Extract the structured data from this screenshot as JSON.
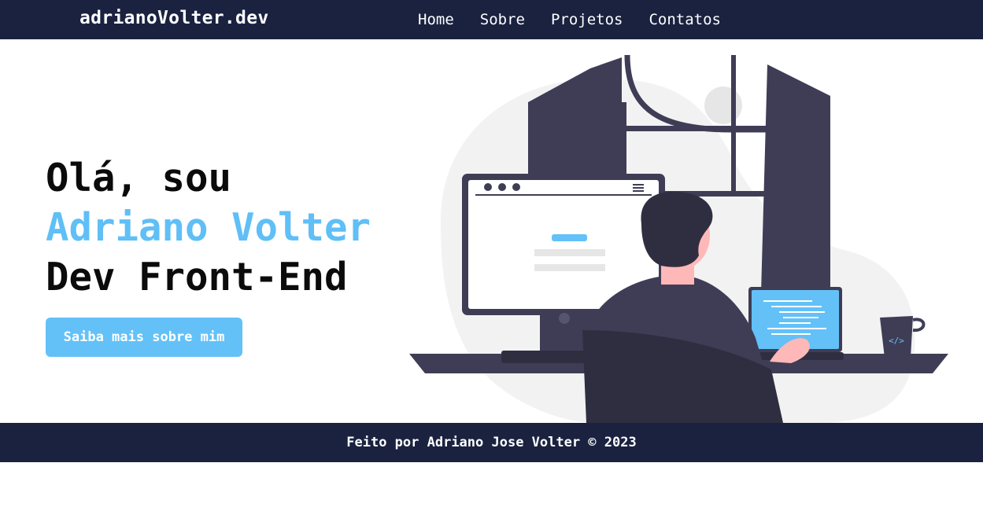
{
  "header": {
    "brand": "adrianoVolter.dev",
    "nav": [
      {
        "label": "Home"
      },
      {
        "label": "Sobre"
      },
      {
        "label": "Projetos"
      },
      {
        "label": "Contatos"
      }
    ]
  },
  "hero": {
    "greeting": "Olá, sou",
    "name": "Adriano Volter",
    "role": "Dev Front-End",
    "cta_label": "Saiba mais sobre mim"
  },
  "illustration": {
    "mug_label": "</>"
  },
  "footer": {
    "text": "Feito por Adriano Jose Volter © 2023"
  },
  "colors": {
    "navy": "#1a2240",
    "accent": "#63c1f8",
    "dark_figure": "#3f3d56",
    "skin": "#ffb8b8"
  }
}
